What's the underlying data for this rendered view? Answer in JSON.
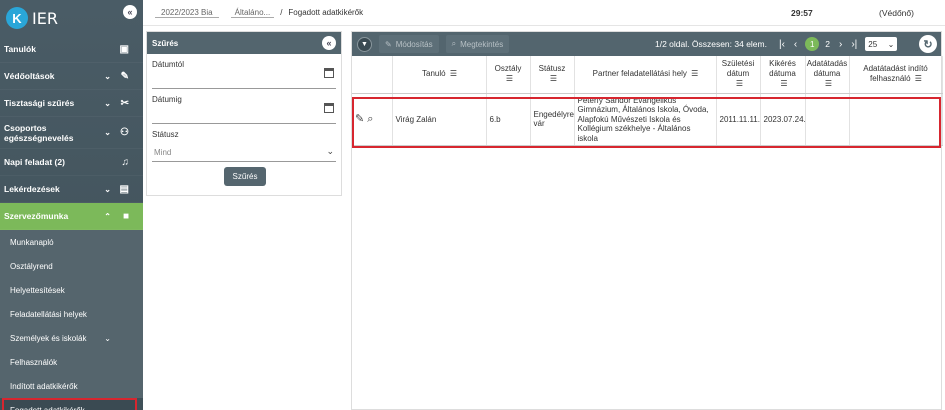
{
  "app": {
    "logo_letter": "K",
    "logo_text": "IER"
  },
  "sidebar": {
    "items": [
      {
        "label": "Tanulók",
        "icon": "id-card-icon"
      },
      {
        "label": "Védőoltások",
        "icon": "syringe-icon"
      },
      {
        "label": "Tisztasági szűrés",
        "icon": "tools-icon"
      },
      {
        "label": "Csoportos egészségnevelés",
        "icon": "group-add-icon"
      },
      {
        "label": "Napi feladat  (2)",
        "icon": "bell-icon"
      },
      {
        "label": "Lekérdezések",
        "icon": "clipboard-icon"
      },
      {
        "label": "Szervezőmunka",
        "icon": "briefcase-icon"
      }
    ],
    "sub_items": [
      "Munkanapló",
      "Osztályrend",
      "Helyettesítések",
      "Feladatellátási helyek",
      "Személyek és iskolák",
      "Felhasználók",
      "Indított adatkikérők",
      "Fogadott adatkikérők"
    ]
  },
  "topbar": {
    "year": "2022/2023 Bia",
    "school": "Általáno...",
    "separator": "/",
    "breadcrumb": "Fogadott adatkikérők",
    "timer": "29:57",
    "role": "(Védőnő)"
  },
  "filter": {
    "title": "Szűrés",
    "date_from_label": "Dátumtól",
    "date_to_label": "Dátumig",
    "status_label": "Státusz",
    "status_value": "Mind",
    "submit_label": "Szűrés"
  },
  "grid": {
    "toolbar": {
      "edit_label": "Módosítás",
      "view_label": "Megtekintés",
      "page_info": "1/2 oldal. Összesen: 34 elem.",
      "page1": "1",
      "page2": "2",
      "page_size": "25"
    },
    "columns": [
      "Tanuló",
      "Osztály",
      "Státusz",
      "Partner feladatellátási hely",
      "Születési dátum",
      "Kikérés dátuma",
      "Adatátadás dátuma",
      "Adatátadást indító felhasználó"
    ],
    "rows": [
      {
        "student": "Virág Zalán",
        "class": "6.b",
        "status": "Engedélyre vár",
        "partner": "Péterfy Sándor Evangélikus Gimnázium, Általános Iskola, Óvoda, Alapfokú Művészeti Iskola és Kollégium székhelye - Általános iskola",
        "birth_date": "2011.11.11.",
        "request_date": "2023.07.24.",
        "transfer_date": "",
        "initiator": ""
      }
    ]
  }
}
